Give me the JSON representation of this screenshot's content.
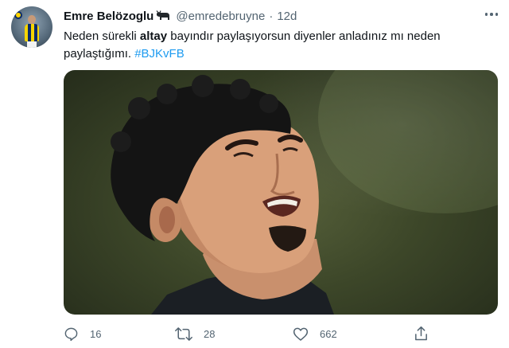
{
  "author": {
    "display_name": "Emre Belözoglu",
    "name_icon": "bull-icon",
    "handle": "@emredebruyne",
    "separator": "·",
    "timestamp": "12d"
  },
  "tweet": {
    "text_before": "Neden sürekli ",
    "text_bold": "altay",
    "text_after": " bayındır paylaşıyorsun diyenler anladınız mı neden paylaştığımı. ",
    "hashtag": "#BJKvFB"
  },
  "media": {
    "description_icon": "football-player-photo"
  },
  "actions": {
    "reply_count": "16",
    "retweet_count": "28",
    "like_count": "662"
  },
  "colors": {
    "accent": "#1d9bf0",
    "text_primary": "#0f1419",
    "text_secondary": "#536471"
  }
}
